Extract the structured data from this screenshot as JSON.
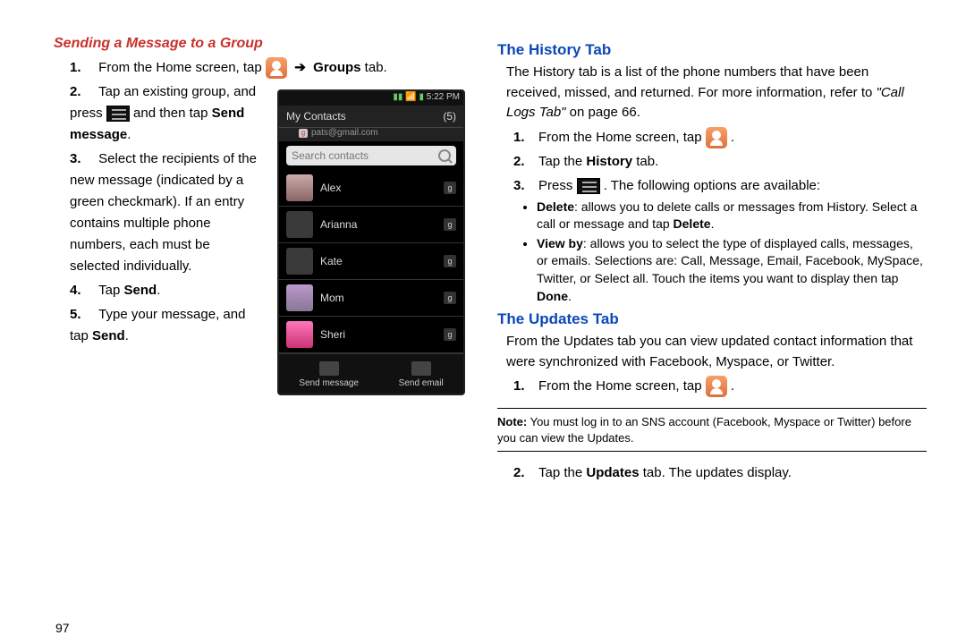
{
  "left": {
    "heading": "Sending a Message to a Group",
    "step1_a": "From the Home screen, tap",
    "step1_b": "Groups",
    "step1_c": " tab.",
    "step2_a": "Tap an existing group, and press ",
    "step2_b": " and then tap ",
    "step2_bold": "Send message",
    "step2_c": ".",
    "step3": "Select the recipients of the new message (indicated by a green checkmark). If an entry contains multiple phone numbers, each must be selected individually.",
    "step4_a": "Tap ",
    "step4_bold": "Send",
    "step4_b": ".",
    "step5_a": "Type your message, and tap ",
    "step5_bold": "Send",
    "step5_b": "."
  },
  "phone": {
    "time": "5:22 PM",
    "title": "My Contacts",
    "count": "(5)",
    "account": "pats@gmail.com",
    "search_placeholder": "Search contacts",
    "contacts": [
      "Alex",
      "Arianna",
      "Kate",
      "Mom",
      "Sheri"
    ],
    "btn_send_msg": "Send message",
    "btn_send_email": "Send email"
  },
  "right": {
    "h_history": "The History Tab",
    "history_intro_a": "The History tab is a list of the phone numbers that have been received, missed, and returned. For more information, refer to ",
    "history_intro_ref": "\"Call Logs Tab\"",
    "history_intro_b": " on page 66.",
    "hist_s1": "From the Home screen, tap ",
    "hist_s1_b": ".",
    "hist_s2_a": "Tap the ",
    "hist_s2_bold": "History",
    "hist_s2_b": " tab.",
    "hist_s3_a": "Press ",
    "hist_s3_b": ". The following options are available:",
    "hist_b1_bold": "Delete",
    "hist_b1": ": allows you to delete calls or messages from History. Select a call or message and tap ",
    "hist_b1_bold2": "Delete",
    "hist_b1_c": ".",
    "hist_b2_bold": "View by",
    "hist_b2": ": allows you to select the type of displayed calls, messages, or emails. Selections are: Call, Message, Email, Facebook, MySpace, Twitter, or Select all. Touch the items you want to display then tap ",
    "hist_b2_bold2": "Done",
    "hist_b2_c": ".",
    "h_updates": "The Updates Tab",
    "updates_intro": "From the Updates tab you can view updated contact information that were synchronized with Facebook, Myspace, or Twitter.",
    "upd_s1": "From the Home screen, tap ",
    "upd_s1_b": ".",
    "note_bold": "Note:",
    "note_text": " You must log in to an SNS account (Facebook, Myspace or Twitter) before you can view the Updates.",
    "upd_s2_a": "Tap the ",
    "upd_s2_bold": "Updates",
    "upd_s2_b": " tab. The updates display."
  },
  "page_number": "97"
}
